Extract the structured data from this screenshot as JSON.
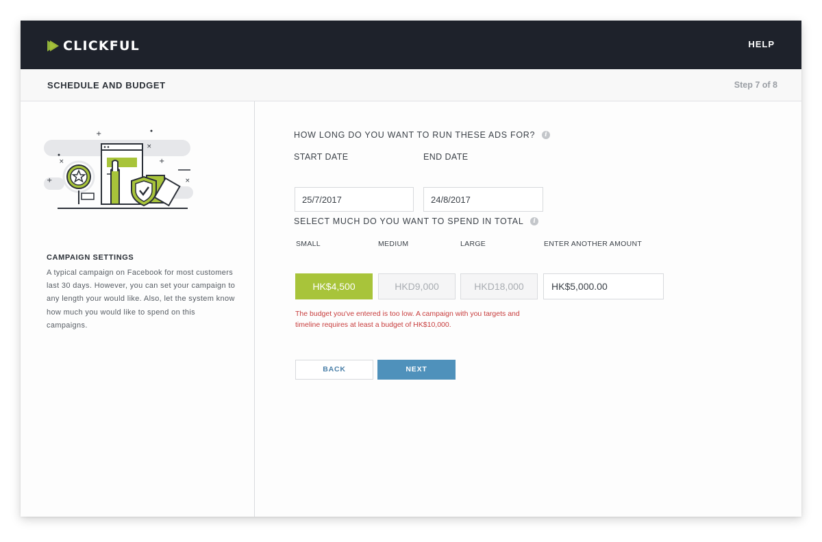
{
  "app": {
    "logo_text": "CLICKFUL",
    "help_label": "HELP",
    "brand_colors": {
      "green": "#a8c43a",
      "blue": "#4f91bb",
      "dark": "#1e222b",
      "error": "#c73c3c"
    }
  },
  "header": {
    "title": "SCHEDULE AND BUDGET",
    "step": "Step 7 of 8"
  },
  "sidebar": {
    "illustration_icon": "campaign-illustration-icon",
    "heading": "CAMPAIGN SETTINGS",
    "description": "A typical campaign on Facebook for most customers last 30 days. However, you can set your campaign to any length your would like. Also, let the system know how much you would like to spend on this campaigns."
  },
  "schedule": {
    "question": "HOW LONG DO YOU WANT TO RUN THESE ADS FOR?",
    "start_label": "START DATE",
    "start_value": "25/7/2017",
    "end_label": "END DATE",
    "end_value": "24/8/2017"
  },
  "budget": {
    "question": "SELECT MUCH DO YOU WANT TO SPEND IN TOTAL",
    "options": [
      {
        "label": "SMALL",
        "value": "HK$4,500",
        "selected": true
      },
      {
        "label": "MEDIUM",
        "value": "HKD9,000",
        "selected": false
      },
      {
        "label": "LARGE",
        "value": "HKD18,000",
        "selected": false
      }
    ],
    "custom_label": "ENTER ANOTHER AMOUNT",
    "custom_value": "HK$5,000.00",
    "error_line1": "The budget you've entered is too low. A campaign with you targets and",
    "error_line2": "timeline requires at least  a budget of HK$10,000."
  },
  "nav": {
    "back_label": "BACK",
    "next_label": "NEXT"
  }
}
